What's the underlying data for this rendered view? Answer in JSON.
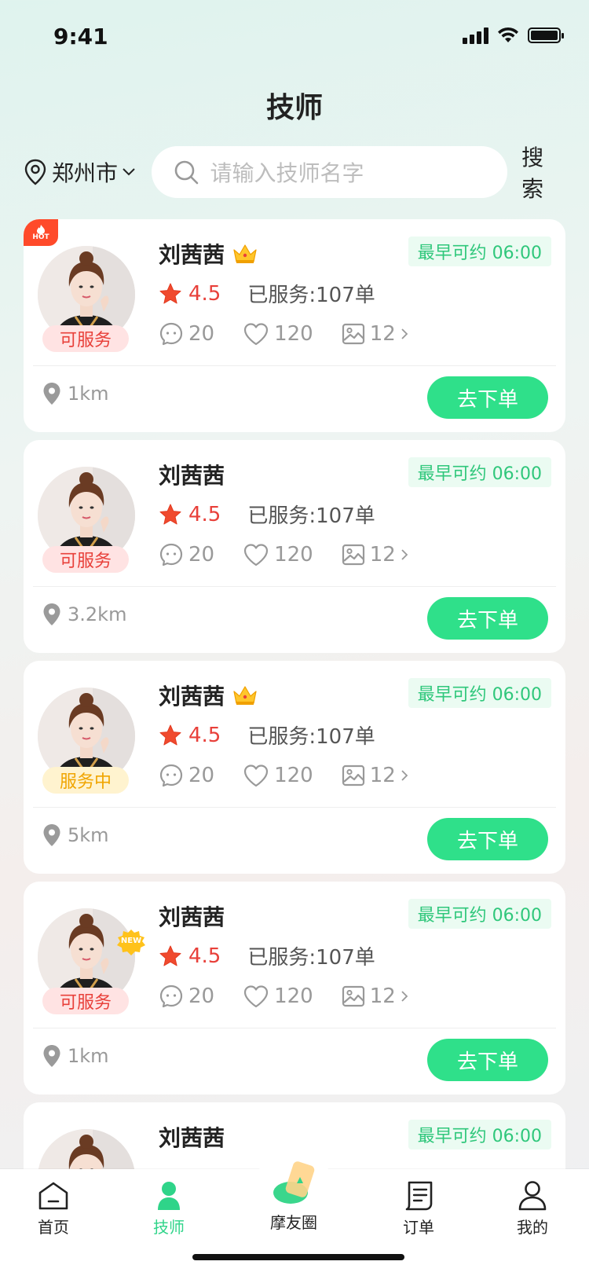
{
  "status_bar": {
    "time": "9:41"
  },
  "page": {
    "title": "技师"
  },
  "search": {
    "city": "郑州市",
    "placeholder": "请输入技师名字",
    "button": "搜索"
  },
  "cards": [
    {
      "name": "刘茜茜",
      "crown": true,
      "hot": true,
      "new": false,
      "earliest": "最早可约 06:00",
      "rating": "4.5",
      "served": "已服务:107单",
      "comments": "20",
      "likes": "120",
      "photos": "12",
      "status": "可服务",
      "status_type": "available",
      "distance": "1km",
      "order_label": "去下单"
    },
    {
      "name": "刘茜茜",
      "crown": false,
      "hot": false,
      "new": false,
      "earliest": "最早可约 06:00",
      "rating": "4.5",
      "served": "已服务:107单",
      "comments": "20",
      "likes": "120",
      "photos": "12",
      "status": "可服务",
      "status_type": "available",
      "distance": "3.2km",
      "order_label": "去下单"
    },
    {
      "name": "刘茜茜",
      "crown": true,
      "hot": false,
      "new": false,
      "earliest": "最早可约 06:00",
      "rating": "4.5",
      "served": "已服务:107单",
      "comments": "20",
      "likes": "120",
      "photos": "12",
      "status": "服务中",
      "status_type": "busy",
      "distance": "5km",
      "order_label": "去下单"
    },
    {
      "name": "刘茜茜",
      "crown": false,
      "hot": false,
      "new": true,
      "earliest": "最早可约 06:00",
      "rating": "4.5",
      "served": "已服务:107单",
      "comments": "20",
      "likes": "120",
      "photos": "12",
      "status": "可服务",
      "status_type": "available",
      "distance": "1km",
      "order_label": "去下单"
    },
    {
      "name": "刘茜茜",
      "crown": false,
      "hot": false,
      "new": false,
      "earliest": "最早可约 06:00",
      "rating": "",
      "served": "",
      "comments": "",
      "likes": "",
      "photos": "",
      "status": "",
      "status_type": "available",
      "distance": "",
      "order_label": ""
    }
  ],
  "badges": {
    "hot": "HOT",
    "new": "NEW"
  },
  "tabs": [
    {
      "label": "首页",
      "icon": "home-icon",
      "active": false
    },
    {
      "label": "技师",
      "icon": "person-icon",
      "active": true
    },
    {
      "label": "摩友圈",
      "icon": "moments-icon",
      "active": false
    },
    {
      "label": "订单",
      "icon": "order-icon",
      "active": false
    },
    {
      "label": "我的",
      "icon": "profile-icon",
      "active": false
    }
  ],
  "colors": {
    "accent": "#2fe08a",
    "tab_active": "#2fd489",
    "rating": "#e8403a",
    "earliest_text": "#2fc77b"
  }
}
